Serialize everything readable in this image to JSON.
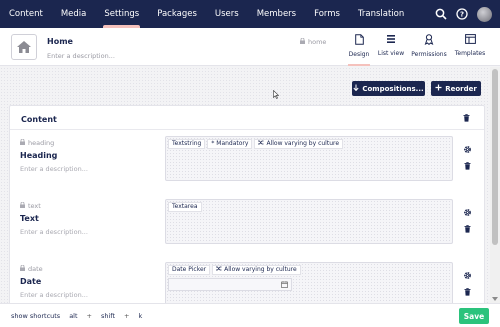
{
  "topnav": {
    "sections": [
      {
        "label": "Content",
        "active": false
      },
      {
        "label": "Media",
        "active": false
      },
      {
        "label": "Settings",
        "active": true
      },
      {
        "label": "Packages",
        "active": false
      },
      {
        "label": "Users",
        "active": false
      },
      {
        "label": "Members",
        "active": false
      },
      {
        "label": "Forms",
        "active": false
      },
      {
        "label": "Translation",
        "active": false
      }
    ],
    "icons": [
      "search-icon",
      "help-icon",
      "user-avatar"
    ]
  },
  "header": {
    "name": "Home",
    "description_placeholder": "Enter a description...",
    "alias": "home",
    "icon": "home-icon",
    "apps": [
      {
        "label": "Design",
        "icon": "document-icon",
        "active": true
      },
      {
        "label": "List view",
        "icon": "list-icon",
        "active": false
      },
      {
        "label": "Permissions",
        "icon": "permissions-icon",
        "active": false
      },
      {
        "label": "Templates",
        "icon": "templates-icon",
        "active": false
      }
    ]
  },
  "toolbar": {
    "compositions_label": "Compositions...",
    "reorder_label": "Reorder"
  },
  "group": {
    "title": "Content",
    "properties": [
      {
        "alias": "heading",
        "name": "Heading",
        "description_placeholder": "Enter a description...",
        "tags": [
          "Textstring",
          "* Mandatory",
          "Allow varying by culture"
        ]
      },
      {
        "alias": "text",
        "name": "Text",
        "description_placeholder": "Enter a description...",
        "tags": [
          "Textarea"
        ]
      },
      {
        "alias": "date",
        "name": "Date",
        "description_placeholder": "Enter a description...",
        "tags": [
          "Date Picker",
          "Allow varying by culture"
        ]
      }
    ]
  },
  "footer": {
    "shortcuts_label": "show shortcuts",
    "keys": [
      "alt",
      "+",
      "shift",
      "+",
      "k"
    ],
    "save_label": "Save"
  },
  "colors": {
    "nav_bg": "#1b264f",
    "active_indicator": "#f5c1bc",
    "primary_button": "#1b264f",
    "save_button": "#2bc37c"
  }
}
